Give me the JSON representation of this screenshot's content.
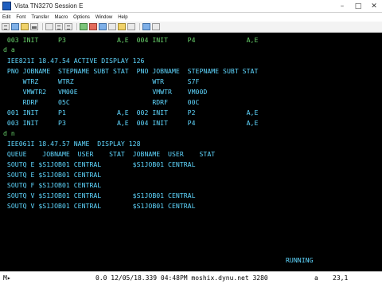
{
  "window": {
    "title": "Vista TN3270 Session E"
  },
  "menu": [
    "Edit",
    "Font",
    "Transfer",
    "Macro",
    "Options",
    "Window",
    "Help"
  ],
  "terminal": {
    "lines": [
      " 003 INIT     P3             A,E  004 INIT     P4             A,E",
      "d a",
      " IEE821I 18.47.54 ACTIVE DISPLAY 126",
      " PNO JOBNAME  STEPNAME SUBT STAT  PNO JOBNAME  STEPNAME SUBT STAT",
      "     WTRZ     WTRZ                    WTR      S7F",
      "     VMWTR2   VM00E                   VMWTR    VM00D",
      "     RDRF     05C                     RDRF     00C",
      " 001 INIT     P1             A,E  002 INIT     P2             A,E",
      " 003 INIT     P3             A,E  004 INIT     P4             A,E",
      "d n",
      " IEE061I 18.47.57 NAME  DISPLAY 128",
      " QUEUE    JOBNAME  USER    STAT  JOBNAME  USER    STAT",
      " SOUTQ E $S1JOB01 CENTRAL        $S1JOB01 CENTRAL",
      " SOUTQ E $S1JOB01 CENTRAL",
      " SOUTQ F $S1JOB01 CENTRAL",
      " SOUTQ V $S1JOB01 CENTRAL        $S1JOB01 CENTRAL",
      " SOUTQ V $S1JOB01 CENTRAL        $S1JOB01 CENTRAL"
    ],
    "running_label": "RUNNING"
  },
  "status": {
    "left": "M▸",
    "middle": "0.0 12/05/18.339 04:48PM moshix.dynu.net 3280",
    "mode": "a",
    "cursor": "23,1"
  }
}
